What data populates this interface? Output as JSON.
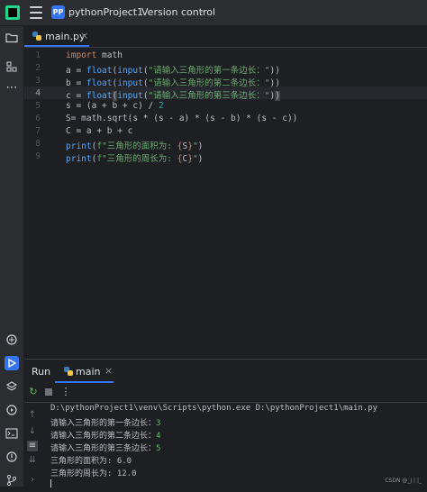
{
  "titlebar": {
    "project_badge": "PP",
    "project_name": "pythonProject1",
    "vcs_label": "Version control"
  },
  "editor": {
    "tab": {
      "label": "main.py",
      "close": "×"
    },
    "line_numbers": [
      "1",
      "2",
      "3",
      "4",
      "5",
      "6",
      "7",
      "8",
      "9"
    ],
    "active_line": 4
  },
  "run_panel": {
    "title": "Run",
    "tab_label": "main",
    "tab_close": "×",
    "command": "D:\\pythonProject1\\venv\\Scripts\\python.exe D:\\pythonProject1\\main.py",
    "prompts": [
      {
        "prompt": "请输入三角形的第一条边长：",
        "input": "3"
      },
      {
        "prompt": "请输入三角形的第二条边长：",
        "input": "4"
      },
      {
        "prompt": "请输入三角形的第三条边长：",
        "input": "5"
      }
    ],
    "result_area": "三角形的面积为: 6.0",
    "result_perimeter": "三角形的周长为: 12.0"
  },
  "watermark": "CSDN @_J | |_",
  "colors": {
    "accent": "#3574f0",
    "keyword": "#cf8e6d",
    "function": "#56a8f5",
    "string": "#6aab73",
    "number": "#2aacb8",
    "user_input": "#5fb865"
  }
}
